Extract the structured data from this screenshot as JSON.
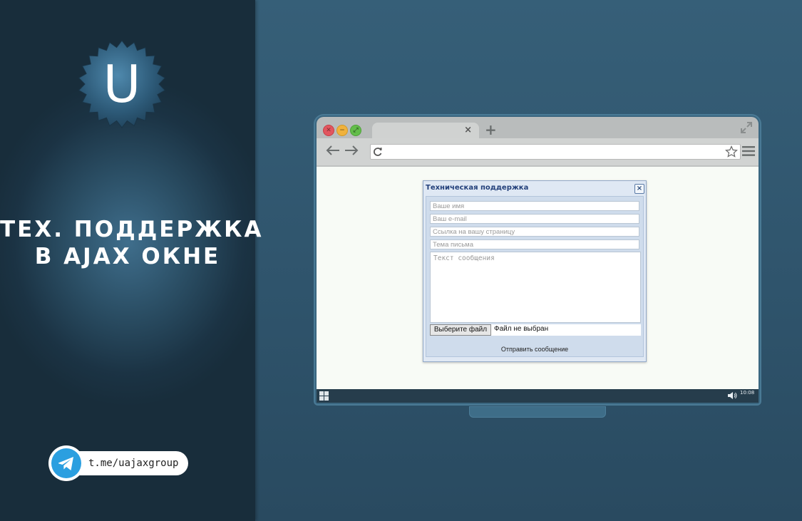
{
  "colors": {
    "background": "#345a73",
    "left_panel": "#1b3344",
    "accent_telegram": "#2b9fe0",
    "dialog_title": "#23407a"
  },
  "branding": {
    "logo_letter": "U",
    "logo_icon": "serrated-badge-icon"
  },
  "promo": {
    "title_line1": "ТЕХ. ПОДДЕРЖКА",
    "title_line2": "В AJAX ОКНЕ"
  },
  "telegram": {
    "icon": "telegram-plane-icon",
    "link_text": "t.me/uajaxgroup"
  },
  "browser": {
    "tab_close": "×",
    "new_tab": "+",
    "taskbar_clock": "10:08"
  },
  "dialog": {
    "title": "Техническая поддержка",
    "close_label": "×",
    "fields": {
      "name_placeholder": "Ваше имя",
      "email_placeholder": "Ваш e-mail",
      "page_link_placeholder": "Ссылка на вашу страницу",
      "subject_placeholder": "Тема письма",
      "message_placeholder": "Текст сообщения"
    },
    "file_button": "Выберите файл",
    "file_status": "Файл не выбран",
    "submit_label": "Отправить сообщение"
  }
}
